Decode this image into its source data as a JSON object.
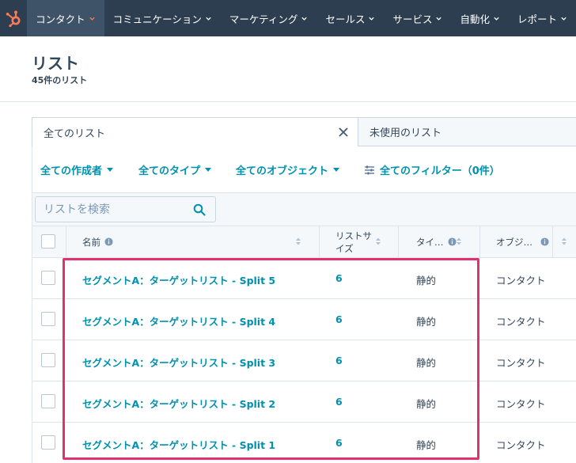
{
  "nav": {
    "logo": "hubspot-sprocket-icon",
    "items": [
      {
        "label": "コンタクト",
        "active": true
      },
      {
        "label": "コミュニケーション",
        "active": false
      },
      {
        "label": "マーケティング",
        "active": false
      },
      {
        "label": "セールス",
        "active": false
      },
      {
        "label": "サービス",
        "active": false
      },
      {
        "label": "自動化",
        "active": false
      },
      {
        "label": "レポート",
        "active": false
      }
    ]
  },
  "header": {
    "title": "リスト",
    "subtitle": "45件のリスト"
  },
  "tabs": {
    "all": "全てのリスト",
    "unused": "未使用のリスト"
  },
  "filters": {
    "creator": "全ての作成者",
    "type": "全てのタイプ",
    "object": "全てのオブジェクト",
    "all_filters": "全てのフィルター（0件）"
  },
  "search": {
    "placeholder": "リストを検索"
  },
  "table": {
    "columns": {
      "name": "名前",
      "size_line1": "リストサ",
      "size_line2": "イズ",
      "type": "タイ…",
      "object": "オブジ…"
    },
    "rows": [
      {
        "name": "セグメントA：ターゲットリスト - Split 5",
        "size": "6",
        "type": "静的",
        "object": "コンタクト"
      },
      {
        "name": "セグメントA：ターゲットリスト - Split 4",
        "size": "6",
        "type": "静的",
        "object": "コンタクト"
      },
      {
        "name": "セグメントA：ターゲットリスト - Split 3",
        "size": "6",
        "type": "静的",
        "object": "コンタクト"
      },
      {
        "name": "セグメントA：ターゲットリスト - Split 2",
        "size": "6",
        "type": "静的",
        "object": "コンタクト"
      },
      {
        "name": "セグメントA：ターゲットリスト - Split 1",
        "size": "6",
        "type": "静的",
        "object": "コンタクト"
      }
    ]
  },
  "colors": {
    "nav_bg": "#2d3e50",
    "link": "#0091ae",
    "highlight": "#e3306e",
    "accent": "#ff7a59"
  }
}
